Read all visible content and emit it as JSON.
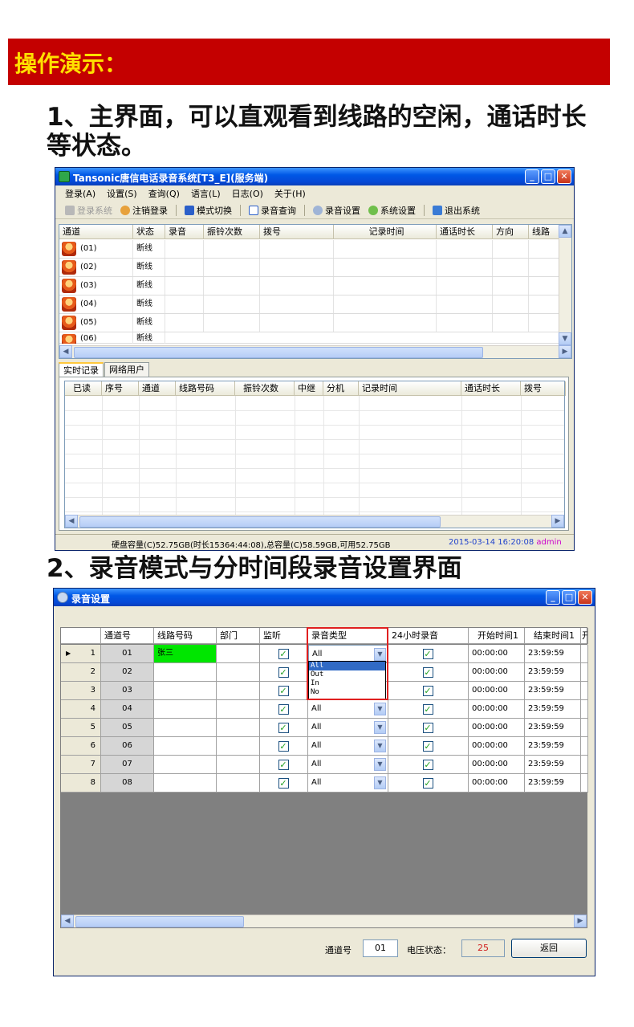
{
  "banner": "操作演示：",
  "step1": "1、主界面，可以直观看到线路的空闲，通话时长等状态。",
  "step2": "2、录音模式与分时间段录音设置界面",
  "main_window": {
    "title": "Tansonic唐信电话录音系统[T3_E](服务端)",
    "menu": [
      "登录(A)",
      "设置(S)",
      "查询(Q)",
      "语言(L)",
      "日志(O)",
      "关于(H)"
    ],
    "toolbar": [
      "登录系统",
      "注销登录",
      "模式切换",
      "录音查询",
      "录音设置",
      "系统设置",
      "退出系统"
    ],
    "columns": [
      "通道",
      "状态",
      "录音",
      "振铃次数",
      "拨号",
      "记录时间",
      "通话时长",
      "方向",
      "线路"
    ],
    "channels": [
      {
        "id": "(01)",
        "status": "断线"
      },
      {
        "id": "(02)",
        "status": "断线"
      },
      {
        "id": "(03)",
        "status": "断线"
      },
      {
        "id": "(04)",
        "status": "断线"
      },
      {
        "id": "(05)",
        "status": "断线"
      },
      {
        "id": "(06)",
        "status": "断线"
      }
    ],
    "tabs": [
      "实时记录",
      "网络用户"
    ],
    "log_columns": [
      "已读",
      "序号",
      "通道",
      "线路号码",
      "振铃次数",
      "中继",
      "分机",
      "记录时间",
      "通话时长",
      "拨号"
    ],
    "status_disk": "硬盘容量(C)52.75GB(时长15364:44:08),总容量(C)58.59GB,可用52.75GB",
    "status_time": "2015-03-14 16:20:08",
    "status_user": "admin"
  },
  "rec_window": {
    "title": "录音设置",
    "columns": [
      "通道号",
      "线路号码",
      "部门",
      "监听",
      "录音类型",
      "24小时录音",
      "开始时间1",
      "结束时间1",
      "开"
    ],
    "rows": [
      {
        "n": "1",
        "ch": "01",
        "line": "张三",
        "type": "All",
        "start": "00:00:00",
        "end": "23:59:59"
      },
      {
        "n": "2",
        "ch": "02",
        "line": "",
        "type": "All",
        "start": "00:00:00",
        "end": "23:59:59"
      },
      {
        "n": "3",
        "ch": "03",
        "line": "",
        "type": "All",
        "start": "00:00:00",
        "end": "23:59:59"
      },
      {
        "n": "4",
        "ch": "04",
        "line": "",
        "type": "All",
        "start": "00:00:00",
        "end": "23:59:59"
      },
      {
        "n": "5",
        "ch": "05",
        "line": "",
        "type": "All",
        "start": "00:00:00",
        "end": "23:59:59"
      },
      {
        "n": "6",
        "ch": "06",
        "line": "",
        "type": "All",
        "start": "00:00:00",
        "end": "23:59:59"
      },
      {
        "n": "7",
        "ch": "07",
        "line": "",
        "type": "All",
        "start": "00:00:00",
        "end": "23:59:59"
      },
      {
        "n": "8",
        "ch": "08",
        "line": "",
        "type": "All",
        "start": "00:00:00",
        "end": "23:59:59"
      }
    ],
    "dropdown_options": [
      "All",
      "Out",
      "In",
      "No"
    ],
    "channel_label": "通道号",
    "channel_value": "01",
    "voltage_label": "电压状态：",
    "voltage_value": "25",
    "back_button": "返回",
    "highlight_color": "#00e600"
  }
}
